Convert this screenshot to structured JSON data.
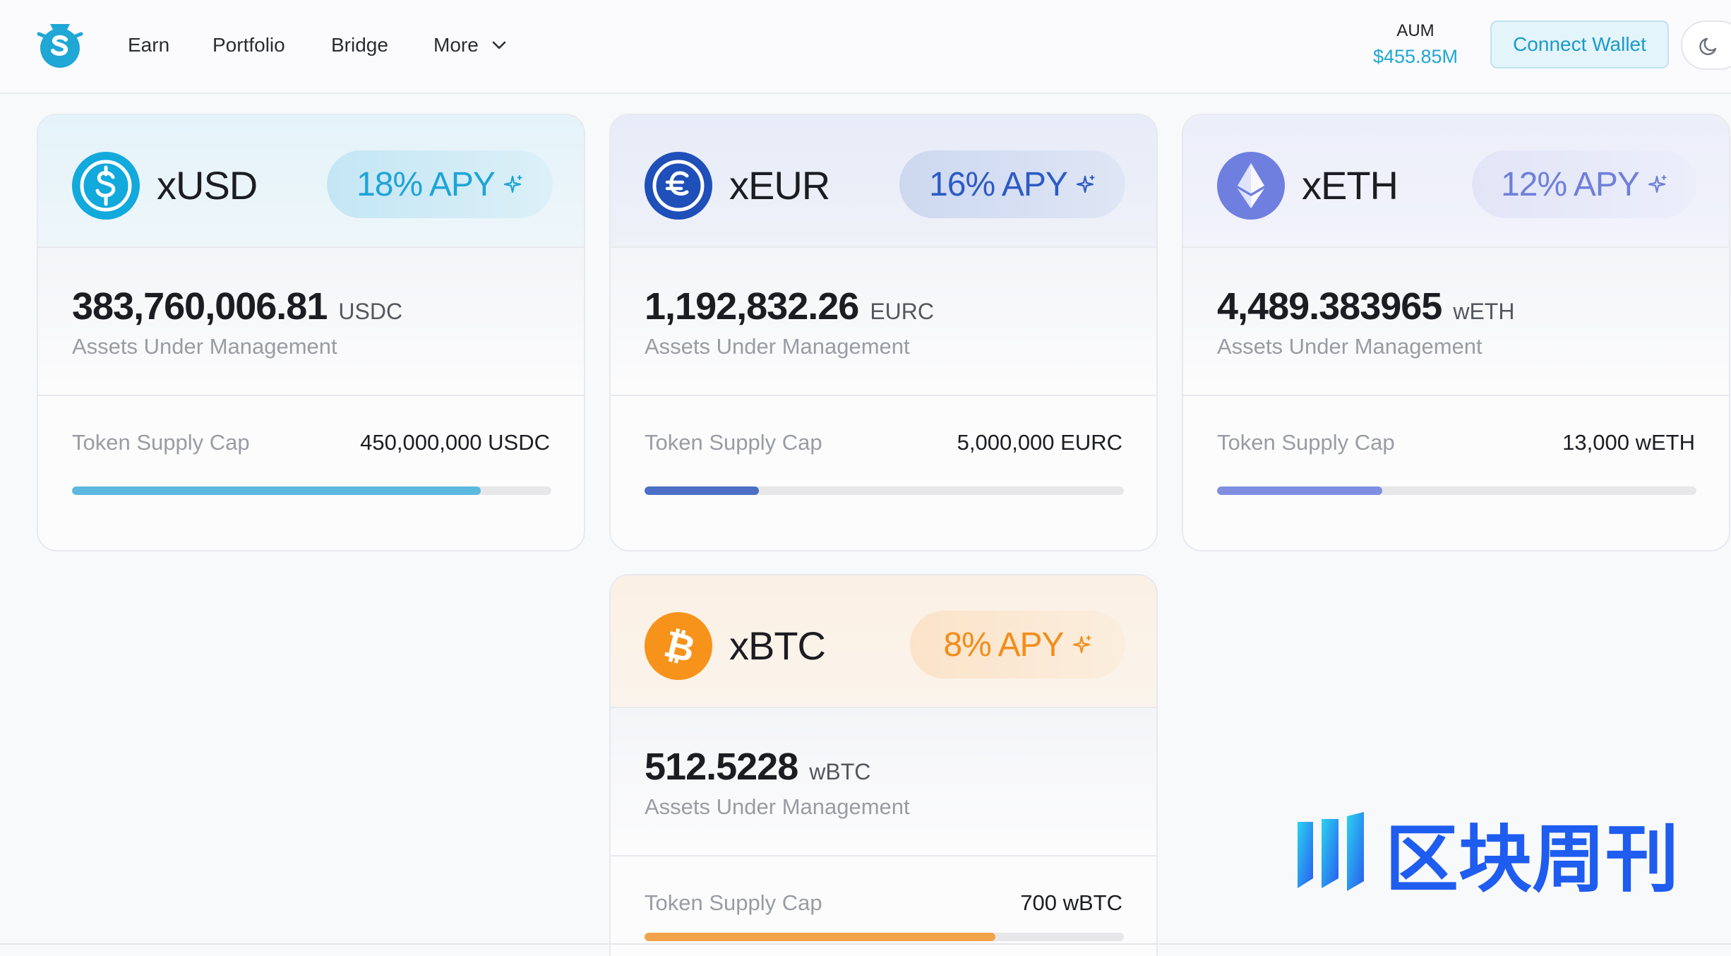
{
  "nav": {
    "earn": "Earn",
    "portfolio": "Portfolio",
    "bridge": "Bridge",
    "more": "More"
  },
  "aum": {
    "label": "AUM",
    "value": "$455.85M"
  },
  "connect_wallet": "Connect Wallet",
  "vaults": [
    {
      "name": "xUSD",
      "apy": "18% APY",
      "amount": "383,760,006.81",
      "amount_unit": "USDC",
      "aum_caption": "Assets Under Management",
      "supply_label": "Token Supply Cap",
      "supply_cap": "450,000,000 USDC",
      "fill_fraction": 0.853,
      "accent": "#1ea4d6"
    },
    {
      "name": "xEUR",
      "apy": "16% APY",
      "amount": "1,192,832.26",
      "amount_unit": "EURC",
      "aum_caption": "Assets Under Management",
      "supply_label": "Token Supply Cap",
      "supply_cap": "5,000,000 EURC",
      "fill_fraction": 0.239,
      "accent": "#2d5bc4"
    },
    {
      "name": "xETH",
      "apy": "12% APY",
      "amount": "4,489.383965",
      "amount_unit": "wETH",
      "aum_caption": "Assets Under Management",
      "supply_label": "Token Supply Cap",
      "supply_cap": "13,000 wETH",
      "fill_fraction": 0.345,
      "accent": "#6f7fda"
    },
    {
      "name": "xBTC",
      "apy": "8% APY",
      "amount": "512.5228",
      "amount_unit": "wBTC",
      "aum_caption": "Assets Under Management",
      "supply_label": "Token Supply Cap",
      "supply_cap": "700 wBTC",
      "fill_fraction": 0.732,
      "accent": "#f28d1a"
    }
  ],
  "watermark": {
    "text": "区块周刊"
  }
}
